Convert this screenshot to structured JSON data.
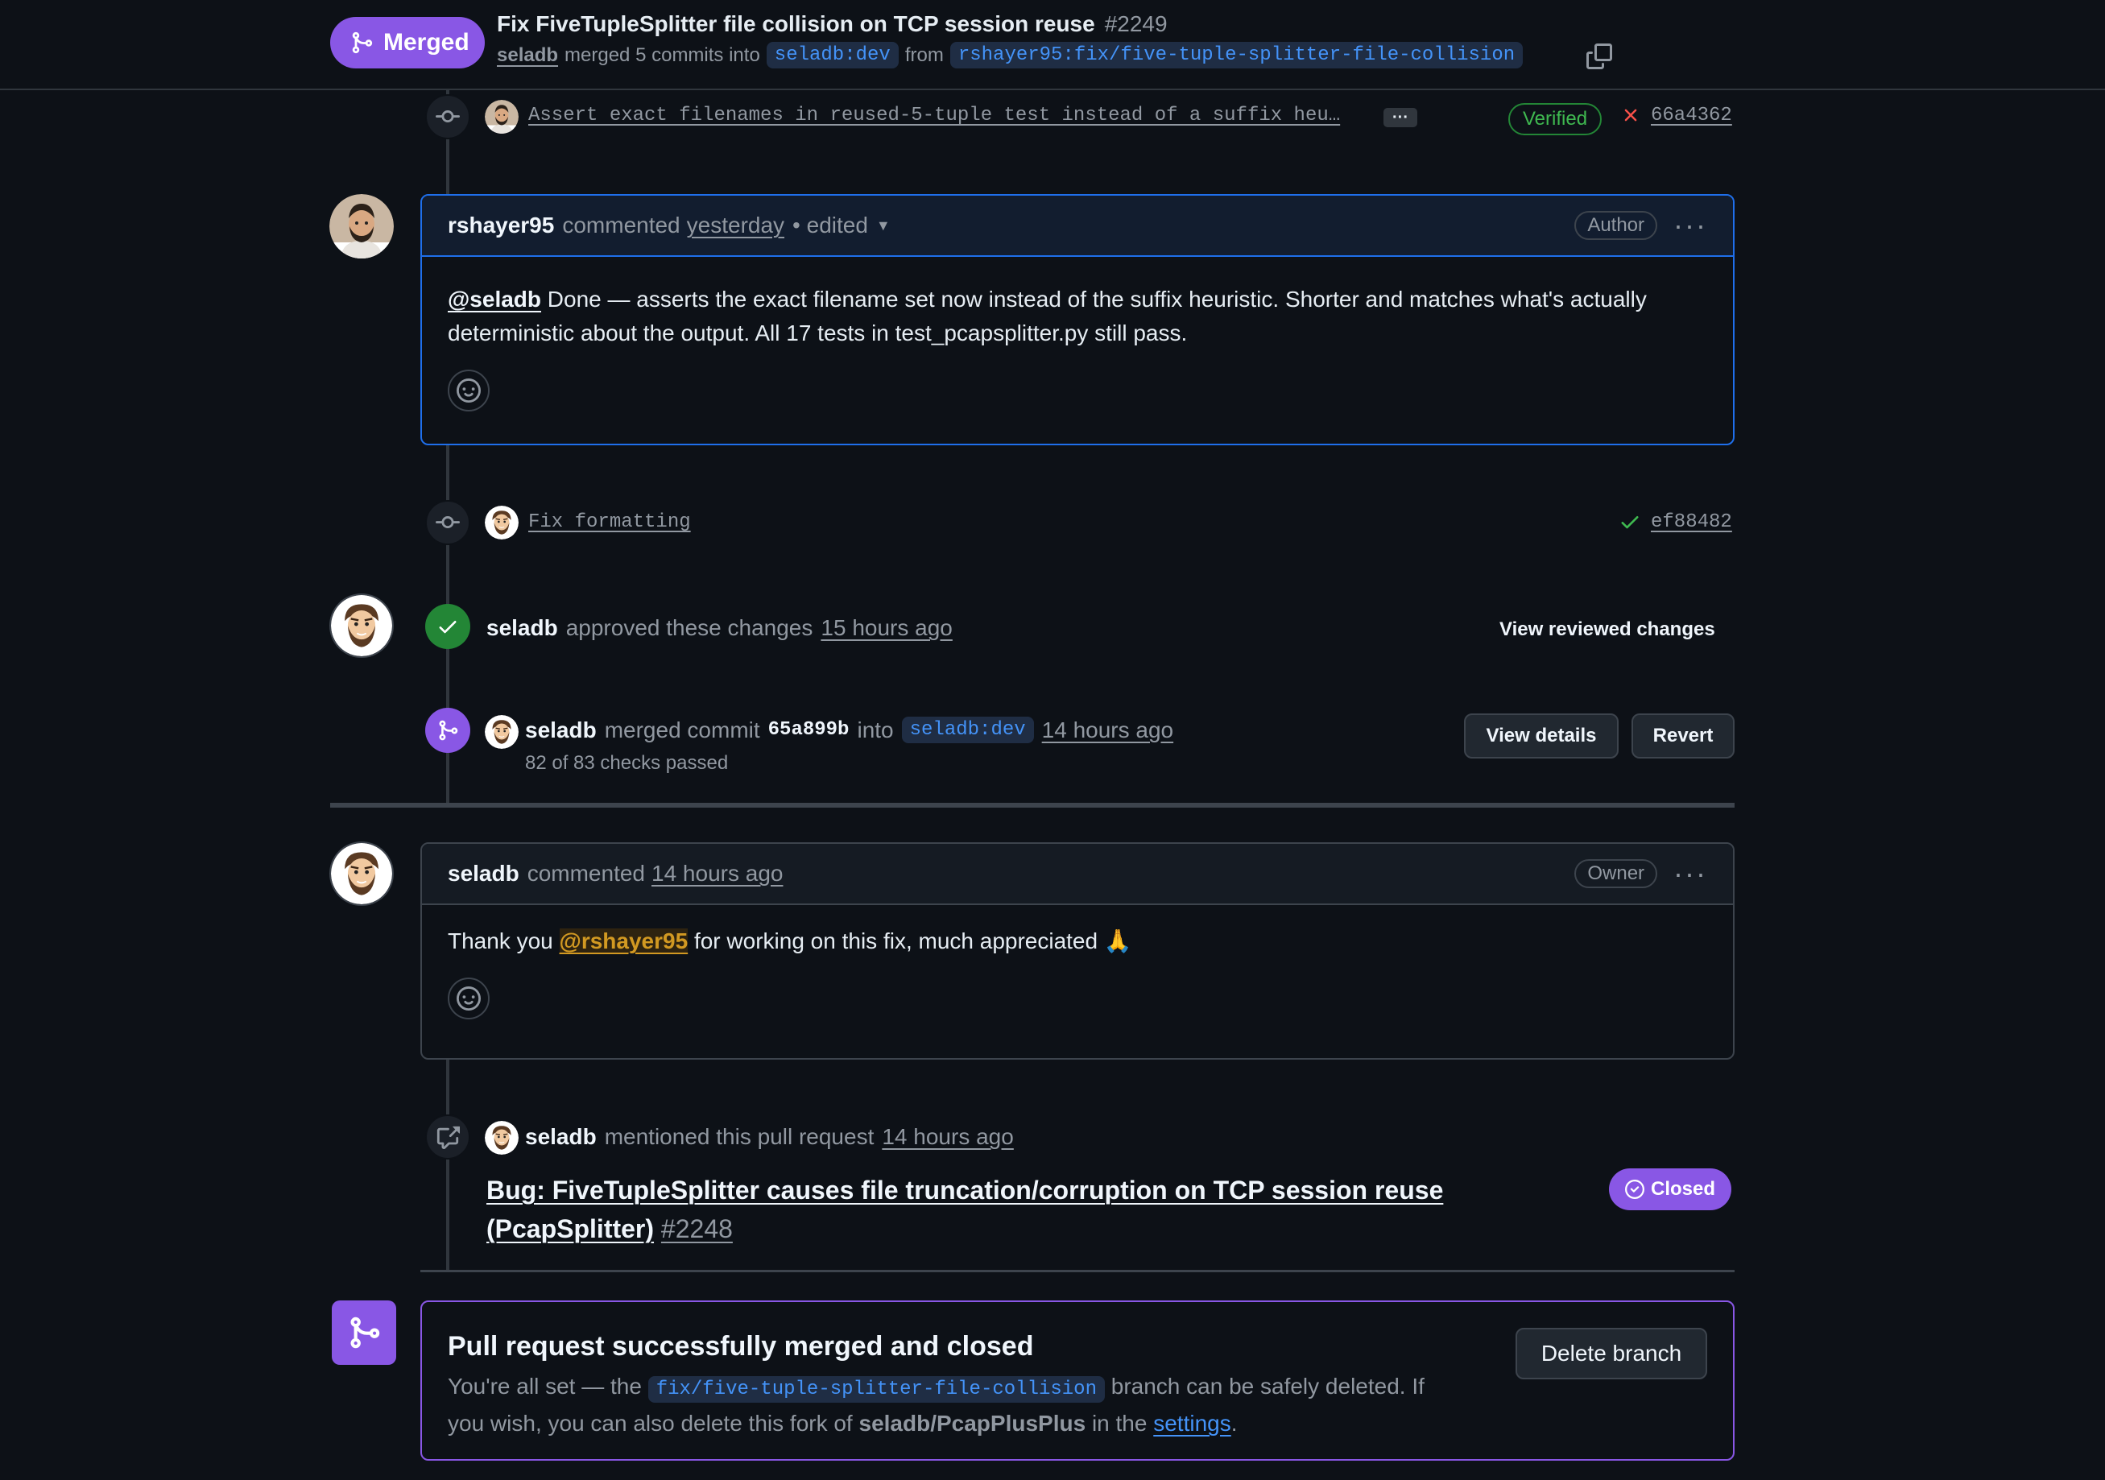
{
  "header": {
    "status": "Merged",
    "title": "Fix FiveTupleSplitter file collision on TCP session reuse",
    "number": "#2249",
    "author": "seladb",
    "merged_text": "merged 5 commits into",
    "base_branch": "seladb:dev",
    "from_text": "from",
    "head_branch": "rshayer95:fix/five-tuple-splitter-file-collision"
  },
  "commit1": {
    "message": "Assert exact filenames in reused-5-tuple test instead of a suffix heu…",
    "ellipsis": "···",
    "verified": "Verified",
    "sha": "66a4362",
    "status_color": "#f85149"
  },
  "comment1": {
    "author": "rshayer95",
    "action": "commented",
    "time": "yesterday",
    "edited": "• edited",
    "role": "Author",
    "mention": "@seladb",
    "body": " Done — asserts the exact filename set now instead of the suffix heuristic. Shorter and matches what's actually deterministic about the output. All 17 tests in test_pcapsplitter.py still pass."
  },
  "commit2": {
    "message": "Fix formatting",
    "sha": "ef88482",
    "status_color": "#3fb950"
  },
  "approval": {
    "author": "seladb",
    "text": "approved these changes",
    "time": "15 hours ago",
    "link": "View reviewed changes"
  },
  "merge_event": {
    "author": "seladb",
    "text": "merged commit",
    "commit": "65a899b",
    "into": "into",
    "branch": "seladb:dev",
    "time": "14 hours ago",
    "checks": "82 of 83 checks passed",
    "details_btn": "View details",
    "revert_btn": "Revert"
  },
  "comment2": {
    "author": "seladb",
    "action": "commented",
    "time": "14 hours ago",
    "role": "Owner",
    "body_pre": "Thank you ",
    "mention": "@rshayer95",
    "body_post": " for working on this fix, much appreciated 🙏"
  },
  "mention_event": {
    "author": "seladb",
    "text": "mentioned this pull request",
    "time": "14 hours ago",
    "issue_title": "Bug: FiveTupleSplitter causes file truncation/corruption on TCP session reuse (PcapSplitter)",
    "issue_number": "#2248",
    "issue_status": "Closed"
  },
  "merged_box": {
    "title": "Pull request successfully merged and closed",
    "text1": "You're all set — the",
    "branch": "fix/five-tuple-splitter-file-collision",
    "text2": "branch can be safely deleted. If",
    "text3": "you wish, you can also delete this fork of",
    "fork": "seladb/PcapPlusPlus",
    "text4": "in the",
    "settings_link": "settings",
    "text5": ".",
    "delete_btn": "Delete branch"
  },
  "colors": {
    "merged_purple": "#8957e5",
    "approved_green": "#238636",
    "link_blue": "#4493f8",
    "mention_yellow": "#d29922"
  }
}
